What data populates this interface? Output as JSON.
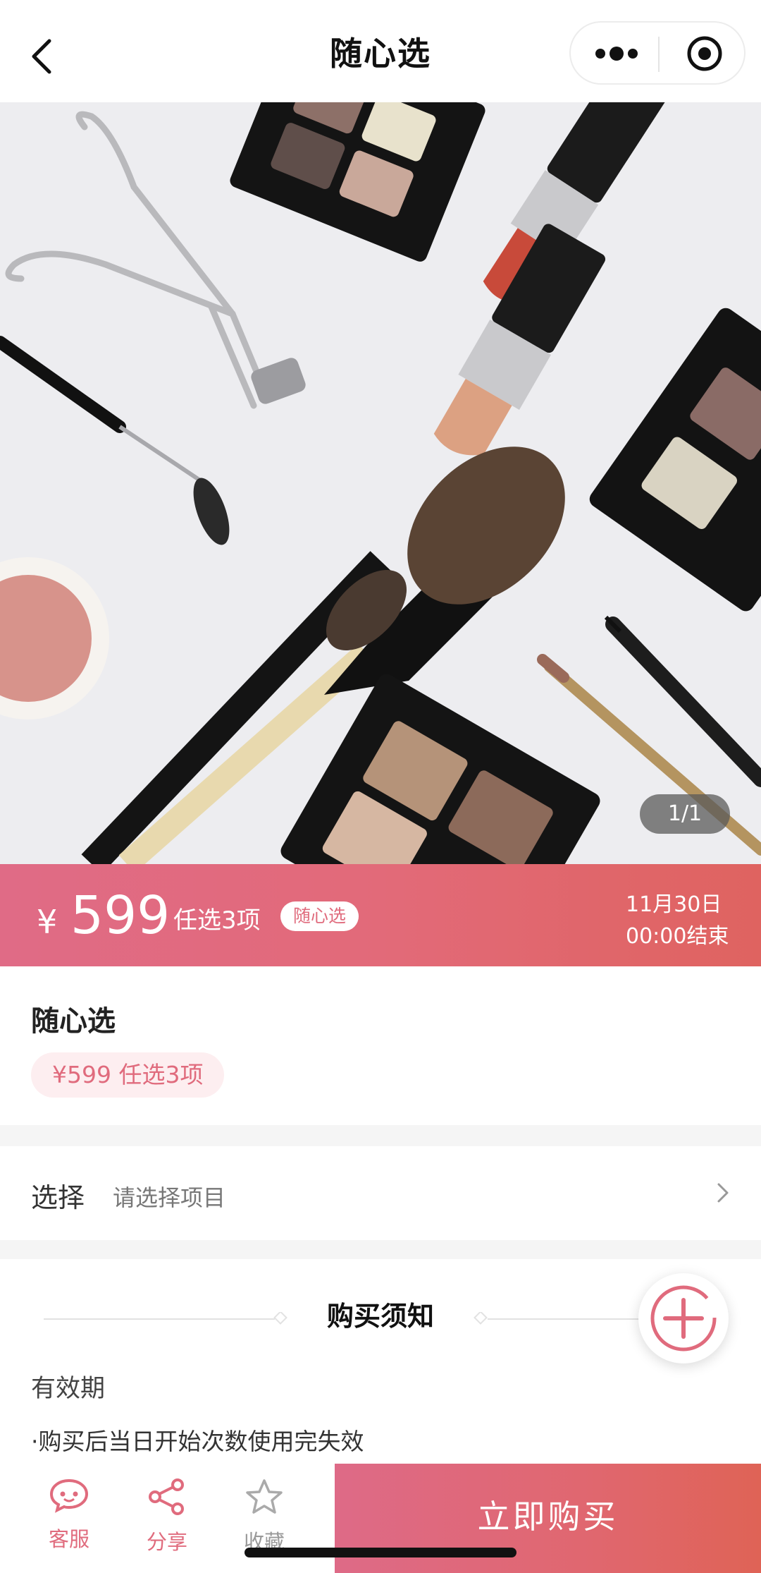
{
  "nav": {
    "title": "随心选"
  },
  "hero": {
    "indicator": "1/1"
  },
  "priceband": {
    "currency": "¥",
    "price": "599",
    "pick": "任选3项",
    "tag": "随心选",
    "end_date": "11月30日",
    "end_time": "00:00结束"
  },
  "product": {
    "name": "随心选",
    "chip": "¥599 任选3项"
  },
  "select": {
    "label": "选择",
    "value": "请选择项目"
  },
  "notice": {
    "title": "购买须知",
    "section": "有效期",
    "rule": "·购买后当日开始次数使用完失效"
  },
  "bottombar": {
    "service": "客服",
    "share": "分享",
    "favorite": "收藏",
    "buy": "立即购买"
  },
  "colors": {
    "accent": "#e06b7d",
    "band_start": "#e06b86",
    "band_end": "#df6360"
  }
}
